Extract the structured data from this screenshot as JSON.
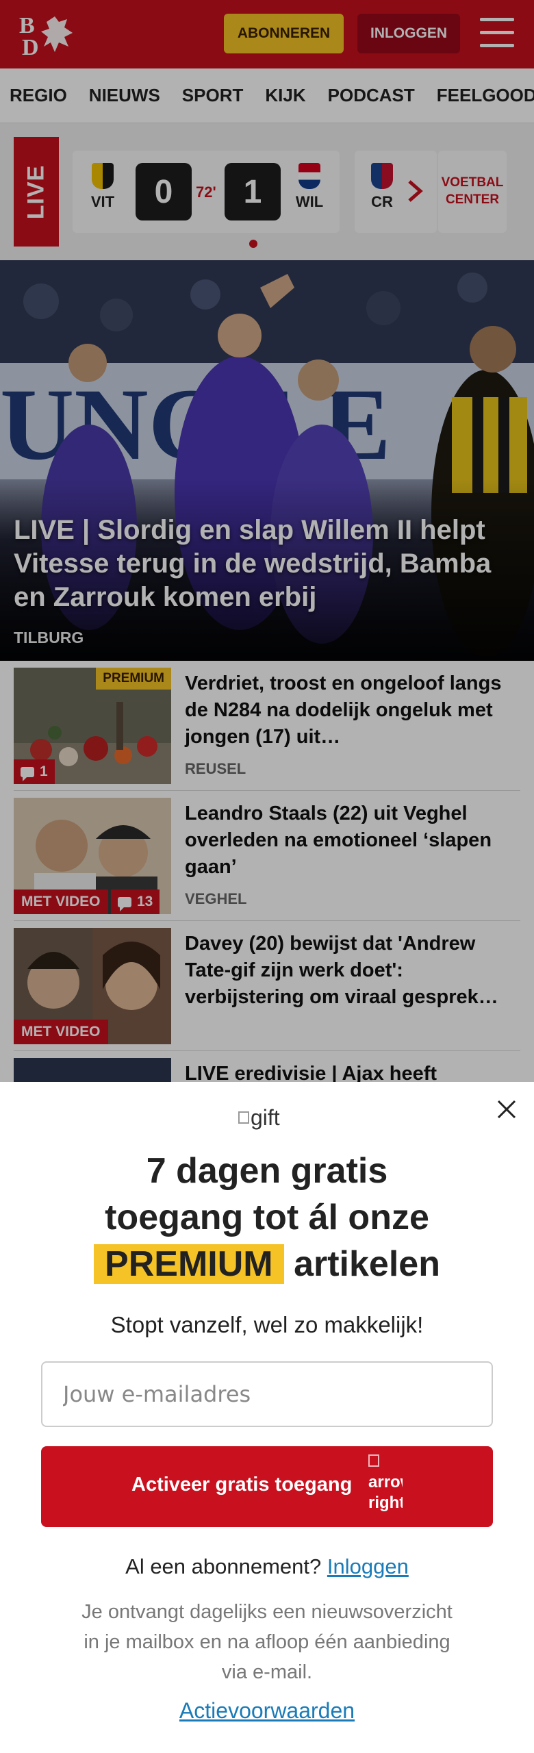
{
  "header": {
    "logo_text": "BD",
    "subscribe_label": "ABONNEREN",
    "login_label": "INLOGGEN",
    "brand_color": "#c8101f",
    "accent_color": "#f5c326"
  },
  "nav": {
    "items": [
      "REGIO",
      "NIEUWS",
      "SPORT",
      "KIJK",
      "PODCAST",
      "FEELGOOD"
    ]
  },
  "live": {
    "badge": "LIVE",
    "match": {
      "home": "VIT",
      "home_score": "0",
      "minute": "72'",
      "away_score": "1",
      "away": "WIL"
    },
    "next_match_team": "CR",
    "voetbal_center": "VOETBAL CENTER"
  },
  "hero": {
    "title": "LIVE | Slordig en slap Willem II helpt Vitesse terug in de wedstrijd, Bamba en Zarrouk komen erbij",
    "location": "TILBURG"
  },
  "articles": [
    {
      "title": "Verdriet, troost en ongeloof langs de N284 na dodelijk ongeluk met jongen (17) uit…",
      "location": "REUSEL",
      "premium": "PREMIUM",
      "comments": "1"
    },
    {
      "title": "Leandro Staals (22) uit Veghel overleden na emotioneel ‘slapen gaan’",
      "location": "VEGHEL",
      "video": "MET VIDEO",
      "comments": "13"
    },
    {
      "title": "Davey (20) bewijst dat 'Andrew Tate-gif zijn werk doet': verbijstering om viraal gesprek…",
      "video": "MET VIDEO"
    },
    {
      "title": "LIVE eredivisie | Ajax heeft"
    }
  ],
  "modal": {
    "gift_alt": "gift",
    "title_line1": "7 dagen gratis",
    "title_line2": "toegang tot ál onze",
    "title_highlight": "PREMIUM",
    "title_line3_rest": "artikelen",
    "subtitle": "Stopt vanzelf, wel zo makkelijk!",
    "email_placeholder": "Jouw e-mailadres",
    "cta_label": "Activeer gratis toegang",
    "cta_icon_alt": "arrow right",
    "already_text": "Al een abonnement?",
    "already_link": "Inloggen",
    "info": "Je ontvangt dagelijks een nieuwsoverzicht in je mailbox en na afloop één aanbieding via e-mail.",
    "conditions": "Actievoorwaarden"
  }
}
